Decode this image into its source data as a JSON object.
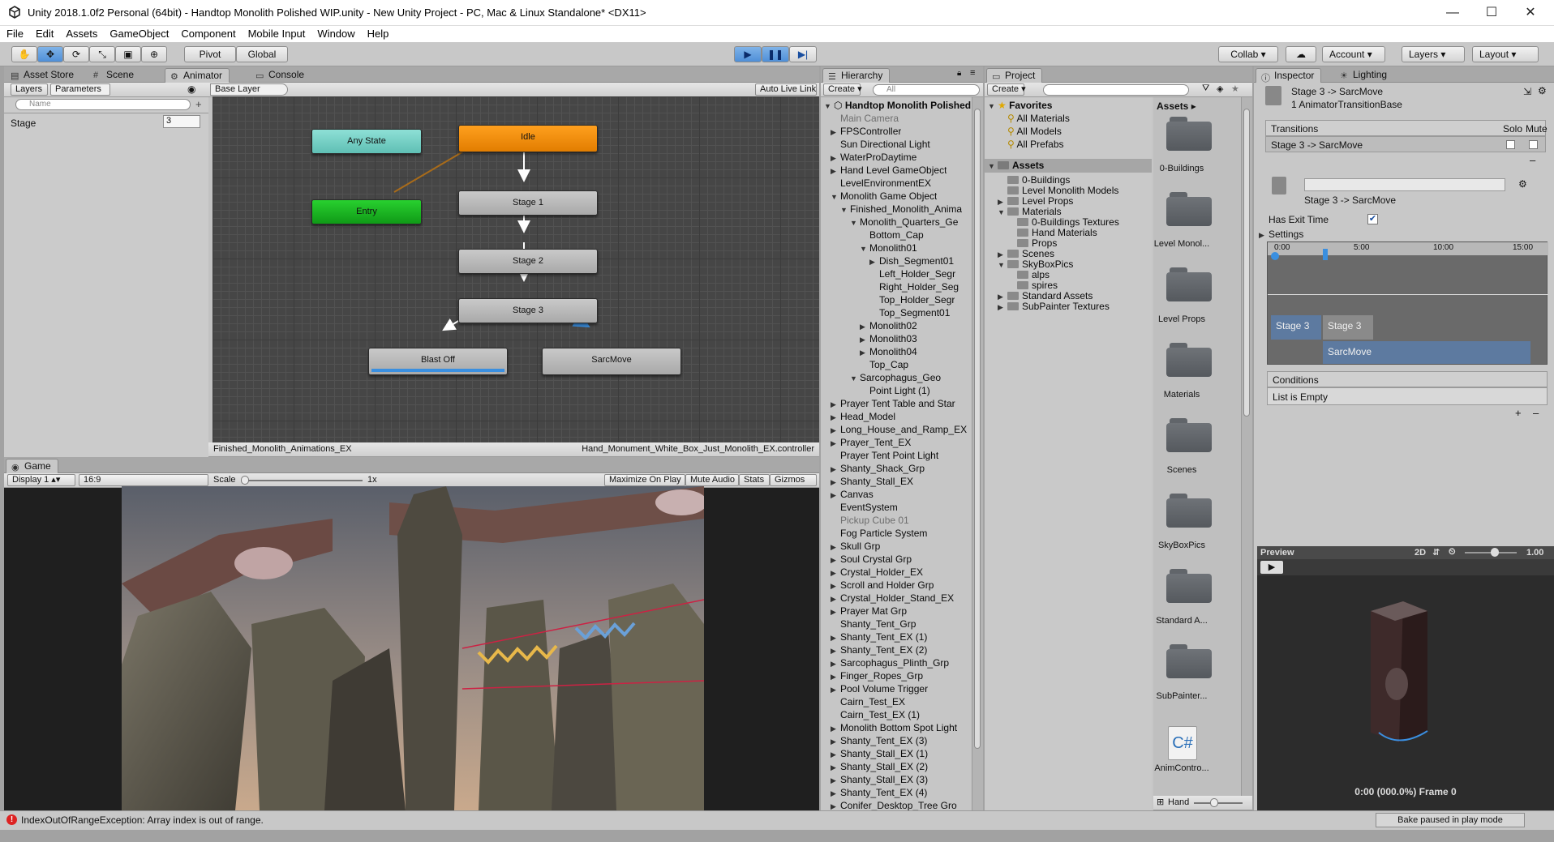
{
  "window": {
    "title": "Unity 2018.1.0f2 Personal (64bit) - Handtop Monolith Polished WIP.unity - New Unity Project - PC, Mac & Linux Standalone* <DX11>",
    "minimize": "—",
    "maximize": "☐",
    "close": "✕"
  },
  "menu": [
    "File",
    "Edit",
    "Assets",
    "GameObject",
    "Component",
    "Mobile Input",
    "Window",
    "Help"
  ],
  "toolbar": {
    "pivot": "Pivot",
    "global": "Global",
    "collab": "Collab ▾",
    "account": "Account",
    "layers": "Layers",
    "layout": "Layout"
  },
  "left_tabs": {
    "asset_store": "Asset Store",
    "scene": "Scene",
    "animator": "Animator",
    "console": "Console"
  },
  "animator": {
    "layers_tab": "Layers",
    "parameters_tab": "Parameters",
    "search_placeholder": "Name",
    "base_layer": "Base Layer",
    "auto_live_link": "Auto Live Link",
    "param_name": "Stage",
    "param_value": "3",
    "nodes": {
      "any_state": "Any State",
      "entry": "Entry",
      "idle": "Idle",
      "stage1": "Stage 1",
      "stage2": "Stage 2",
      "stage3": "Stage 3",
      "blast_off": "Blast Off",
      "sarc_move": "SarcMove"
    },
    "footer_left": "Finished_Monolith_Animations_EX",
    "footer_right": "Hand_Monument_White_Box_Just_Monolith_EX.controller"
  },
  "game": {
    "tab": "Game",
    "display": "Display 1",
    "aspect": "16:9",
    "scale_label": "Scale",
    "scale_value": "1x",
    "maximize_on_play": "Maximize On Play",
    "mute_audio": "Mute Audio",
    "stats": "Stats",
    "gizmos": "Gizmos"
  },
  "hierarchy": {
    "tab": "Hierarchy",
    "create": "Create",
    "search_placeholder": "All",
    "scene_name": "Handtop Monolith Polished",
    "items": [
      {
        "label": "Main Camera",
        "depth": 1,
        "arrow": "",
        "dim": true
      },
      {
        "label": "FPSController",
        "depth": 1,
        "arrow": "▶",
        "dim": false
      },
      {
        "label": "Sun Directional Light",
        "depth": 1,
        "arrow": "",
        "dim": false
      },
      {
        "label": "WaterProDaytime",
        "depth": 1,
        "arrow": "▶",
        "dim": false
      },
      {
        "label": "Hand Level GameObject",
        "depth": 1,
        "arrow": "▶",
        "dim": false
      },
      {
        "label": "LevelEnvironmentEX",
        "depth": 1,
        "arrow": "",
        "dim": false
      },
      {
        "label": "Monolith Game Object",
        "depth": 1,
        "arrow": "▼",
        "dim": false
      },
      {
        "label": "Finished_Monolith_Anima",
        "depth": 2,
        "arrow": "▼",
        "dim": false
      },
      {
        "label": "Monolith_Quarters_Ge",
        "depth": 3,
        "arrow": "▼",
        "dim": false
      },
      {
        "label": "Bottom_Cap",
        "depth": 4,
        "arrow": "",
        "dim": false
      },
      {
        "label": "Monolith01",
        "depth": 4,
        "arrow": "▼",
        "dim": false
      },
      {
        "label": "Dish_Segment01",
        "depth": 5,
        "arrow": "▶",
        "dim": false
      },
      {
        "label": "Left_Holder_Segr",
        "depth": 5,
        "arrow": "",
        "dim": false
      },
      {
        "label": "Right_Holder_Seg",
        "depth": 5,
        "arrow": "",
        "dim": false
      },
      {
        "label": "Top_Holder_Segr",
        "depth": 5,
        "arrow": "",
        "dim": false
      },
      {
        "label": "Top_Segment01",
        "depth": 5,
        "arrow": "",
        "dim": false
      },
      {
        "label": "Monolith02",
        "depth": 4,
        "arrow": "▶",
        "dim": false
      },
      {
        "label": "Monolith03",
        "depth": 4,
        "arrow": "▶",
        "dim": false
      },
      {
        "label": "Monolith04",
        "depth": 4,
        "arrow": "▶",
        "dim": false
      },
      {
        "label": "Top_Cap",
        "depth": 4,
        "arrow": "",
        "dim": false
      },
      {
        "label": "Sarcophagus_Geo",
        "depth": 3,
        "arrow": "▼",
        "dim": false
      },
      {
        "label": "Point Light (1)",
        "depth": 4,
        "arrow": "",
        "dim": false
      },
      {
        "label": "Prayer Tent Table and Star",
        "depth": 1,
        "arrow": "▶",
        "dim": false
      },
      {
        "label": "Head_Model",
        "depth": 1,
        "arrow": "▶",
        "dim": false
      },
      {
        "label": "Long_House_and_Ramp_EX",
        "depth": 1,
        "arrow": "▶",
        "dim": false
      },
      {
        "label": "Prayer_Tent_EX",
        "depth": 1,
        "arrow": "▶",
        "dim": false
      },
      {
        "label": "Prayer Tent Point Light",
        "depth": 1,
        "arrow": "",
        "dim": false
      },
      {
        "label": "Shanty_Shack_Grp",
        "depth": 1,
        "arrow": "▶",
        "dim": false
      },
      {
        "label": "Shanty_Stall_EX",
        "depth": 1,
        "arrow": "▶",
        "dim": false
      },
      {
        "label": "Canvas",
        "depth": 1,
        "arrow": "▶",
        "dim": false
      },
      {
        "label": "EventSystem",
        "depth": 1,
        "arrow": "",
        "dim": false
      },
      {
        "label": "Pickup Cube 01",
        "depth": 1,
        "arrow": "",
        "dim": true
      },
      {
        "label": "Fog Particle System",
        "depth": 1,
        "arrow": "",
        "dim": false
      },
      {
        "label": "Skull Grp",
        "depth": 1,
        "arrow": "▶",
        "dim": false
      },
      {
        "label": "Soul Crystal Grp",
        "depth": 1,
        "arrow": "▶",
        "dim": false
      },
      {
        "label": "Crystal_Holder_EX",
        "depth": 1,
        "arrow": "▶",
        "dim": false
      },
      {
        "label": "Scroll and Holder Grp",
        "depth": 1,
        "arrow": "▶",
        "dim": false
      },
      {
        "label": "Crystal_Holder_Stand_EX",
        "depth": 1,
        "arrow": "▶",
        "dim": false
      },
      {
        "label": "Prayer Mat Grp",
        "depth": 1,
        "arrow": "▶",
        "dim": false
      },
      {
        "label": "Shanty_Tent_Grp",
        "depth": 1,
        "arrow": "",
        "dim": false
      },
      {
        "label": "Shanty_Tent_EX (1)",
        "depth": 1,
        "arrow": "▶",
        "dim": false
      },
      {
        "label": "Shanty_Tent_EX (2)",
        "depth": 1,
        "arrow": "▶",
        "dim": false
      },
      {
        "label": "Sarcophagus_Plinth_Grp",
        "depth": 1,
        "arrow": "▶",
        "dim": false
      },
      {
        "label": "Finger_Ropes_Grp",
        "depth": 1,
        "arrow": "▶",
        "dim": false
      },
      {
        "label": "Pool Volume Trigger",
        "depth": 1,
        "arrow": "▶",
        "dim": false
      },
      {
        "label": "Cairn_Test_EX",
        "depth": 1,
        "arrow": "",
        "dim": false
      },
      {
        "label": "Cairn_Test_EX (1)",
        "depth": 1,
        "arrow": "",
        "dim": false
      },
      {
        "label": "Monolith Bottom Spot Light",
        "depth": 1,
        "arrow": "▶",
        "dim": false
      },
      {
        "label": "Shanty_Tent_EX (3)",
        "depth": 1,
        "arrow": "▶",
        "dim": false
      },
      {
        "label": "Shanty_Stall_EX (1)",
        "depth": 1,
        "arrow": "▶",
        "dim": false
      },
      {
        "label": "Shanty_Stall_EX (2)",
        "depth": 1,
        "arrow": "▶",
        "dim": false
      },
      {
        "label": "Shanty_Stall_EX (3)",
        "depth": 1,
        "arrow": "▶",
        "dim": false
      },
      {
        "label": "Shanty_Tent_EX (4)",
        "depth": 1,
        "arrow": "▶",
        "dim": false
      },
      {
        "label": "Conifer_Desktop_Tree Gro",
        "depth": 1,
        "arrow": "▶",
        "dim": false
      }
    ]
  },
  "project": {
    "tab": "Project",
    "create": "Create",
    "favorites": "Favorites",
    "fav_items": [
      "All Materials",
      "All Models",
      "All Prefabs"
    ],
    "assets_header": "Assets",
    "tree": [
      {
        "label": "0-Buildings",
        "depth": 1,
        "arrow": ""
      },
      {
        "label": "Level Monolith Models",
        "depth": 1,
        "arrow": ""
      },
      {
        "label": "Level Props",
        "depth": 1,
        "arrow": "▶"
      },
      {
        "label": "Materials",
        "depth": 1,
        "arrow": "▼"
      },
      {
        "label": "0-Buildings Textures",
        "depth": 2,
        "arrow": ""
      },
      {
        "label": "Hand Materials",
        "depth": 2,
        "arrow": ""
      },
      {
        "label": "Props",
        "depth": 2,
        "arrow": ""
      },
      {
        "label": "Scenes",
        "depth": 1,
        "arrow": "▶"
      },
      {
        "label": "SkyBoxPics",
        "depth": 1,
        "arrow": "▼"
      },
      {
        "label": "alps",
        "depth": 2,
        "arrow": ""
      },
      {
        "label": "spires",
        "depth": 2,
        "arrow": ""
      },
      {
        "label": "Standard Assets",
        "depth": 1,
        "arrow": "▶"
      },
      {
        "label": "SubPainter Textures",
        "depth": 1,
        "arrow": "▶"
      }
    ],
    "grid_header": "Assets ▸",
    "grid_items": [
      "0-Buildings",
      "Level Monol...",
      "Level Props",
      "Materials",
      "Scenes",
      "SkyBoxPics",
      "Standard A...",
      "SubPainter...",
      "AnimContro..."
    ],
    "script_glyph": "C#",
    "footer_label": "Hand"
  },
  "inspector": {
    "tab": "Inspector",
    "lighting_tab": "Lighting",
    "header_title": "Stage 3 -> SarcMove",
    "header_sub": "1 AnimatorTransitionBase",
    "transitions_label": "Transitions",
    "solo": "Solo",
    "mute": "Mute",
    "transition_item": "Stage 3 -> SarcMove",
    "transition_name": "Stage 3 -> SarcMove",
    "has_exit_time": "Has Exit Time",
    "settings": "Settings",
    "timeline_ticks": [
      "0:00",
      "5:00",
      "10:00",
      "15:00"
    ],
    "clip_stage3_a": "Stage 3",
    "clip_stage3_b": "Stage 3",
    "clip_sarcmove": "SarcMove",
    "conditions": "Conditions",
    "list_empty": "List is Empty",
    "preview_label": "Preview",
    "preview_2d": "2D",
    "preview_speed": "1.00",
    "preview_frame": "0:00 (000.0%) Frame 0"
  },
  "status": {
    "error": "IndexOutOfRangeException: Array index is out of range.",
    "bake": "Bake paused in play mode"
  },
  "colors": {
    "idle_node": "#f08c00",
    "entry_node": "#16b01d",
    "any_state_node": "#6cc7bd",
    "selected_transition": "#3a8fe0",
    "play_active": "#4f8fd8"
  }
}
